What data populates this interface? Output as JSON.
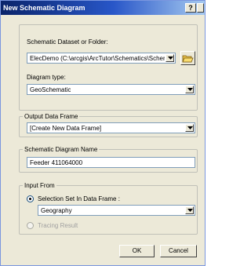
{
  "window": {
    "title": "New Schematic Diagram",
    "help_label": "?"
  },
  "dataset": {
    "label": "Schematic Dataset or Folder:",
    "value": "ElecDemo (C:\\arcgis\\ArcTutor\\Schematics\\Schem"
  },
  "diagram_type": {
    "label": "Diagram type:",
    "value": "GeoSchematic"
  },
  "output_data_frame": {
    "legend": "Output Data Frame",
    "value": "[Create New Data Frame]"
  },
  "diagram_name": {
    "legend": "Schematic Diagram Name",
    "value": "Feeder 411064000"
  },
  "input_from": {
    "legend": "Input From",
    "option_selection_set": "Selection Set In Data Frame :",
    "selection_set_value": "Geography",
    "option_tracing_result": "Tracing Result"
  },
  "buttons": {
    "ok": "OK",
    "cancel": "Cancel"
  },
  "icons": {
    "dropdown": "chevron-down-icon",
    "browse": "open-folder-icon",
    "close": "close-icon"
  }
}
